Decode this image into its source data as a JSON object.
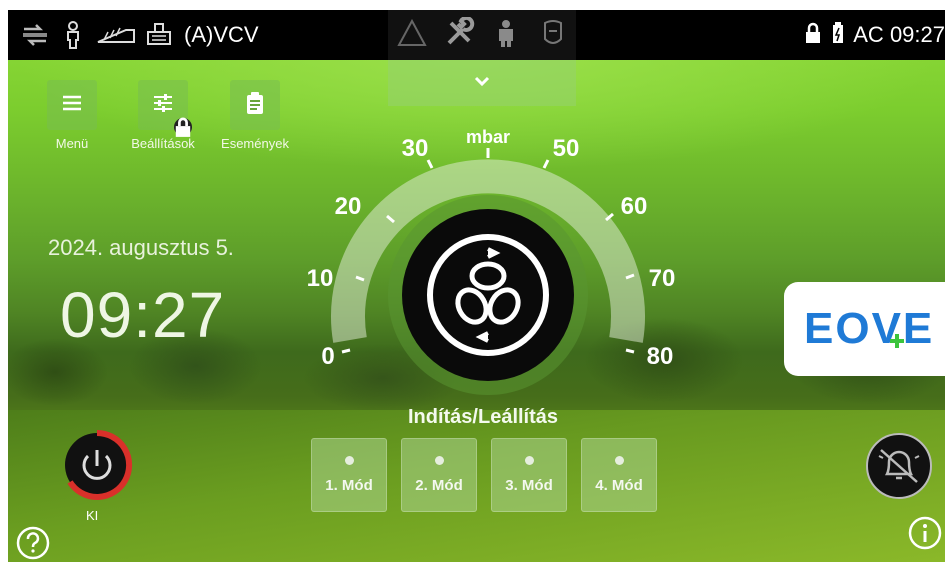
{
  "status_bar": {
    "ventilation_mode": "(A)VCV",
    "power_source": "AC",
    "time": "09:27",
    "icons": [
      "connectivity-icon",
      "patient-icon",
      "circuit-icon",
      "valve-icon"
    ]
  },
  "top_center_tabs": [
    {
      "name": "alarm-triangle-icon"
    },
    {
      "name": "tools-icon"
    },
    {
      "name": "robot-icon"
    },
    {
      "name": "mask-icon"
    }
  ],
  "quick_buttons": {
    "menu_label": "Menü",
    "settings_label": "Beállítások",
    "events_label": "Események"
  },
  "date_text": "2024. augusztus 5.",
  "clock_text": "09:27",
  "power": {
    "label": "KI"
  },
  "gauge": {
    "unit": "mbar",
    "ticks": [
      "0",
      "10",
      "20",
      "30",
      "50",
      "60",
      "70",
      "80"
    ]
  },
  "start_stop_label": "Indítás/Leállítás",
  "modes": [
    {
      "label": "1. Mód"
    },
    {
      "label": "2. Mód"
    },
    {
      "label": "3. Mód"
    },
    {
      "label": "4. Mód"
    }
  ],
  "brand": {
    "text": "EOVE"
  },
  "colors": {
    "brand_blue": "#1f7ad6",
    "power_ring": "#d9302a",
    "brand_plus": "#3cc43c"
  }
}
